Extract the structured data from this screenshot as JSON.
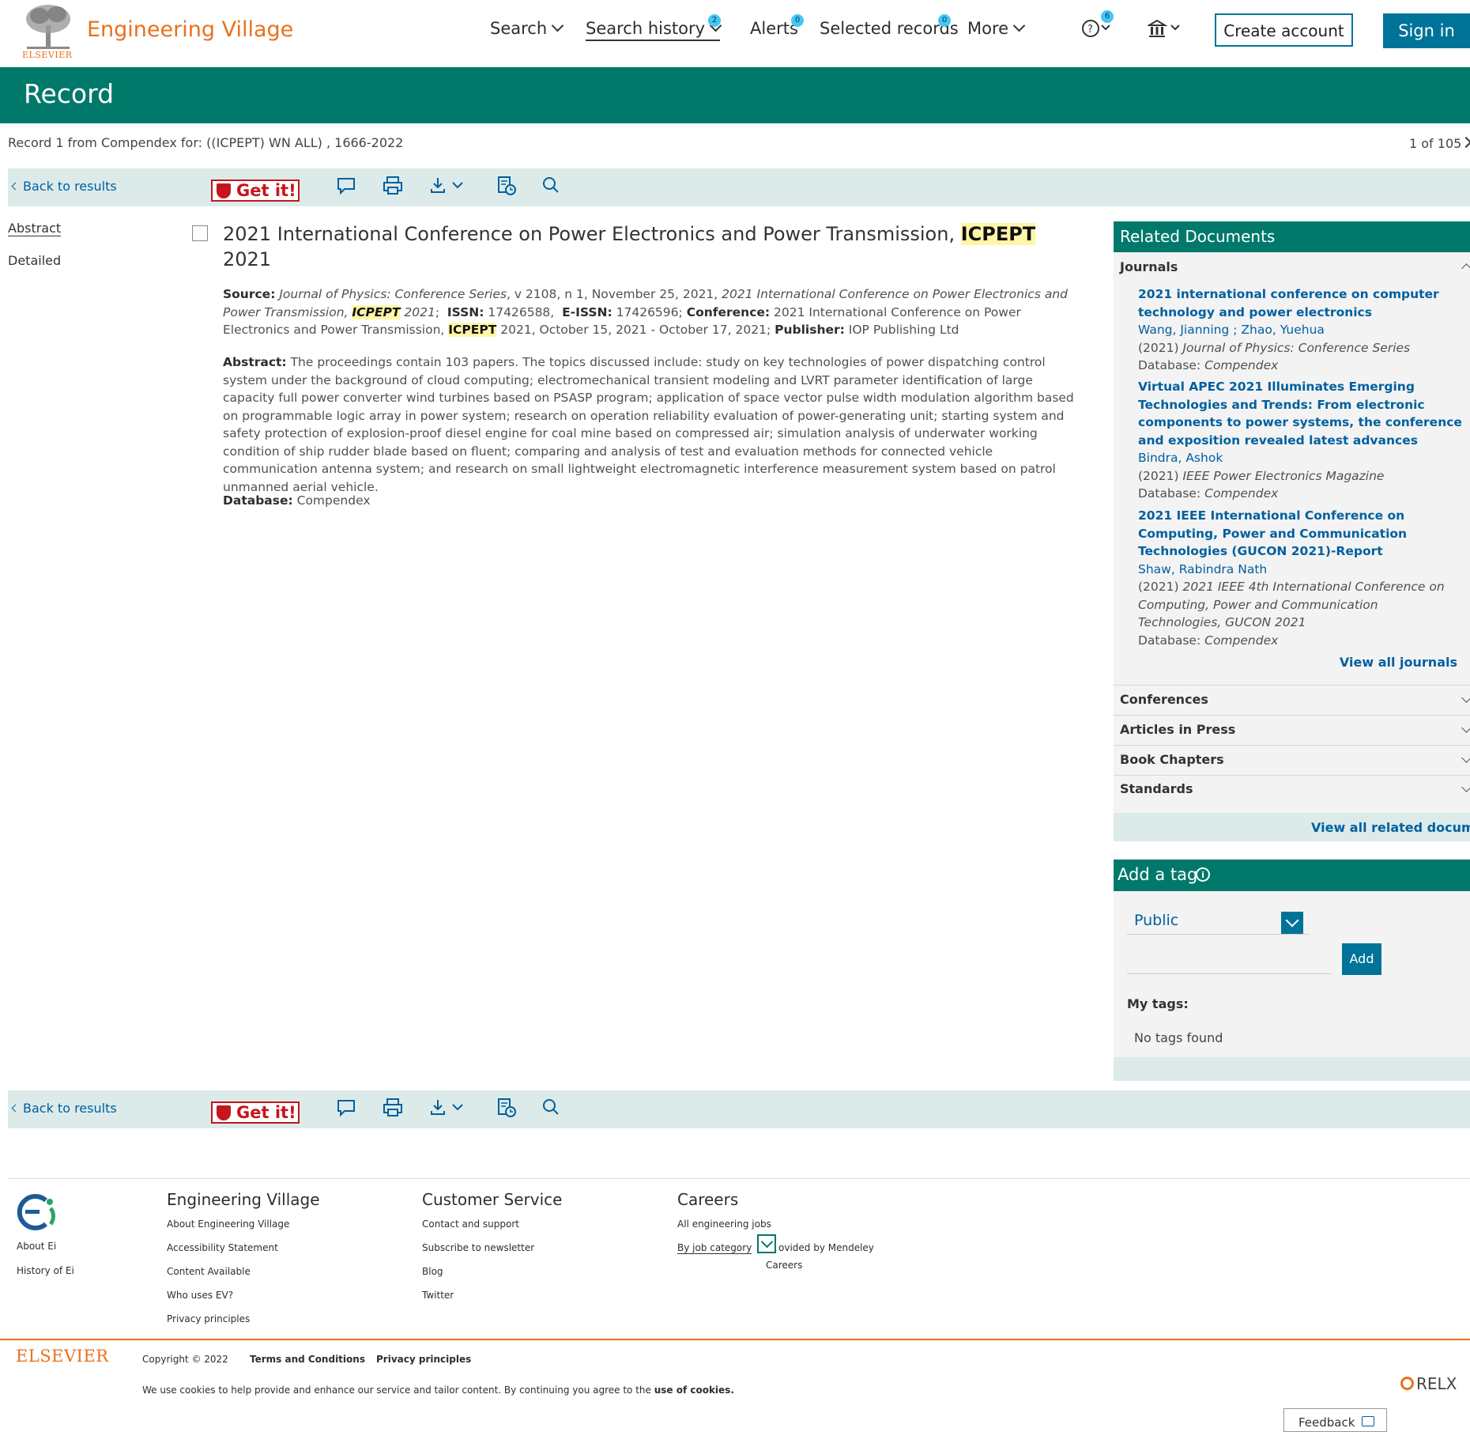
{
  "header": {
    "brand_name": "Engineering Village",
    "brand_company": "ELSEVIER",
    "nav": {
      "search": "Search",
      "search_history": "Search history",
      "search_history_badge": "2",
      "alerts": "Alerts",
      "alerts_badge": "0",
      "selected_records": "Selected records",
      "selected_badge": "0",
      "more": "More",
      "help_badge": "6"
    },
    "create_account": "Create account",
    "sign_in": "Sign in"
  },
  "banner": {
    "title": "Record"
  },
  "record_info": "Record 1 from Compendex for: ((ICPEPT) WN ALL) , 1666-2022",
  "record_count": "1 of 105",
  "toolbar": {
    "back": "Back to results",
    "getit": "Get it!"
  },
  "tabs": {
    "abstract": "Abstract",
    "detailed": "Detailed"
  },
  "record": {
    "title_pre": "2021 International Conference on Power Electronics and Power Transmission, ",
    "title_hl": "ICPEPT",
    "title_post": " 2021",
    "source_label": "Source:",
    "source_journal": "Journal of Physics: Conference Series",
    "source_vol": ", v 2108, n 1, November 25, 2021, ",
    "source_conf_italic": "2021 International Conference on Power Electronics and Power Transmission, ",
    "source_conf_hl": "ICPEPT",
    "source_conf_year": " 2021",
    "issn_label": "ISSN:",
    "issn": "17426588,",
    "eissn_label": "E-ISSN:",
    "eissn": "17426596;",
    "conference_label": "Conference:",
    "conference": "2021 International Conference on Power Electronics and Power Transmission, ",
    "conference_hl": "ICPEPT",
    "conference_dates": " 2021, October 15, 2021 - October 17, 2021;",
    "publisher_label": "Publisher:",
    "publisher": "IOP Publishing Ltd",
    "abstract_label": "Abstract:",
    "abstract": "The proceedings contain 103 papers. The topics discussed include: study on key technologies of power dispatching control system under the background of cloud computing; electromechanical transient modeling and LVRT parameter identification of large capacity full power converter wind turbines based on PSASP program; application of space vector pulse width modulation algorithm based on programmable logic array in power system; research on operation reliability evaluation of power-generating unit; starting system and safety protection of explosion-proof diesel engine for coal mine based on compressed air; simulation analysis of underwater working condition of ship rudder blade based on fluent; comparing and analysis of test and evaluation methods for connected vehicle communication antenna system; and research on small lightweight electromagnetic interference measurement system based on patrol unmanned aerial vehicle.",
    "database_label": "Database:",
    "database": "Compendex"
  },
  "related": {
    "title": "Related Documents",
    "journals_label": "Journals",
    "items": [
      {
        "title": "2021 international conference on computer technology and power electronics",
        "authors": "Wang, Jianning ; Zhao, Yuehua",
        "year": "(2021)",
        "pub": "Journal of Physics: Conference Series",
        "db_label": "Database:",
        "db": "Compendex"
      },
      {
        "title": "Virtual APEC 2021 Illuminates Emerging Technologies and Trends: From electronic components to power systems, the conference and exposition revealed latest advances",
        "authors": "Bindra, Ashok",
        "year": "(2021)",
        "pub": "IEEE Power Electronics Magazine",
        "db_label": "Database:",
        "db": "Compendex"
      },
      {
        "title": "2021 IEEE International Conference on Computing, Power and Communication Technologies (GUCON 2021)-Report",
        "authors": "Shaw, Rabindra Nath",
        "year": "(2021)",
        "pub": "2021 IEEE 4th International Conference on Computing, Power and Communication Technologies, GUCON 2021",
        "db_label": "Database:",
        "db": "Compendex"
      }
    ],
    "view_all_journals": "View all journals",
    "sections": [
      "Conferences",
      "Articles in Press",
      "Book Chapters",
      "Standards"
    ],
    "view_all_related": "View all related documents"
  },
  "tag": {
    "title": "Add a tag",
    "visibility": "Public",
    "add": "Add",
    "my_tags": "My tags:",
    "none": "No tags found"
  },
  "footer": {
    "about_ei": "About Ei",
    "history_ei": "History of Ei",
    "col1_head": "Engineering Village",
    "col1": [
      "About Engineering Village",
      "Accessibility Statement",
      "Content Available",
      "Who uses EV?",
      "Privacy principles"
    ],
    "col2_head": "Customer Service",
    "col2": [
      "Contact and support",
      "Subscribe to newsletter",
      "Blog",
      "Twitter"
    ],
    "col3_head": "Careers",
    "col3_all": "All engineering jobs",
    "col3_by": "By job category",
    "col3_provided": "ovided by Mendeley",
    "col3_careers": "Careers",
    "elsevier": "ELSEVIER",
    "copyright": "Copyright © 2022",
    "terms": "Terms and Conditions",
    "privacy": "Privacy principles",
    "cookie_text": "We use cookies to help provide and enhance our service and tailor content. By continuing you agree to the ",
    "cookie_link": "use of cookies.",
    "relx": "RELX",
    "feedback": "Feedback"
  },
  "colors": {
    "teal": "#00796b",
    "brand_orange": "#e9711c",
    "link": "#00609f",
    "toolbar_bg": "#dcebea"
  }
}
